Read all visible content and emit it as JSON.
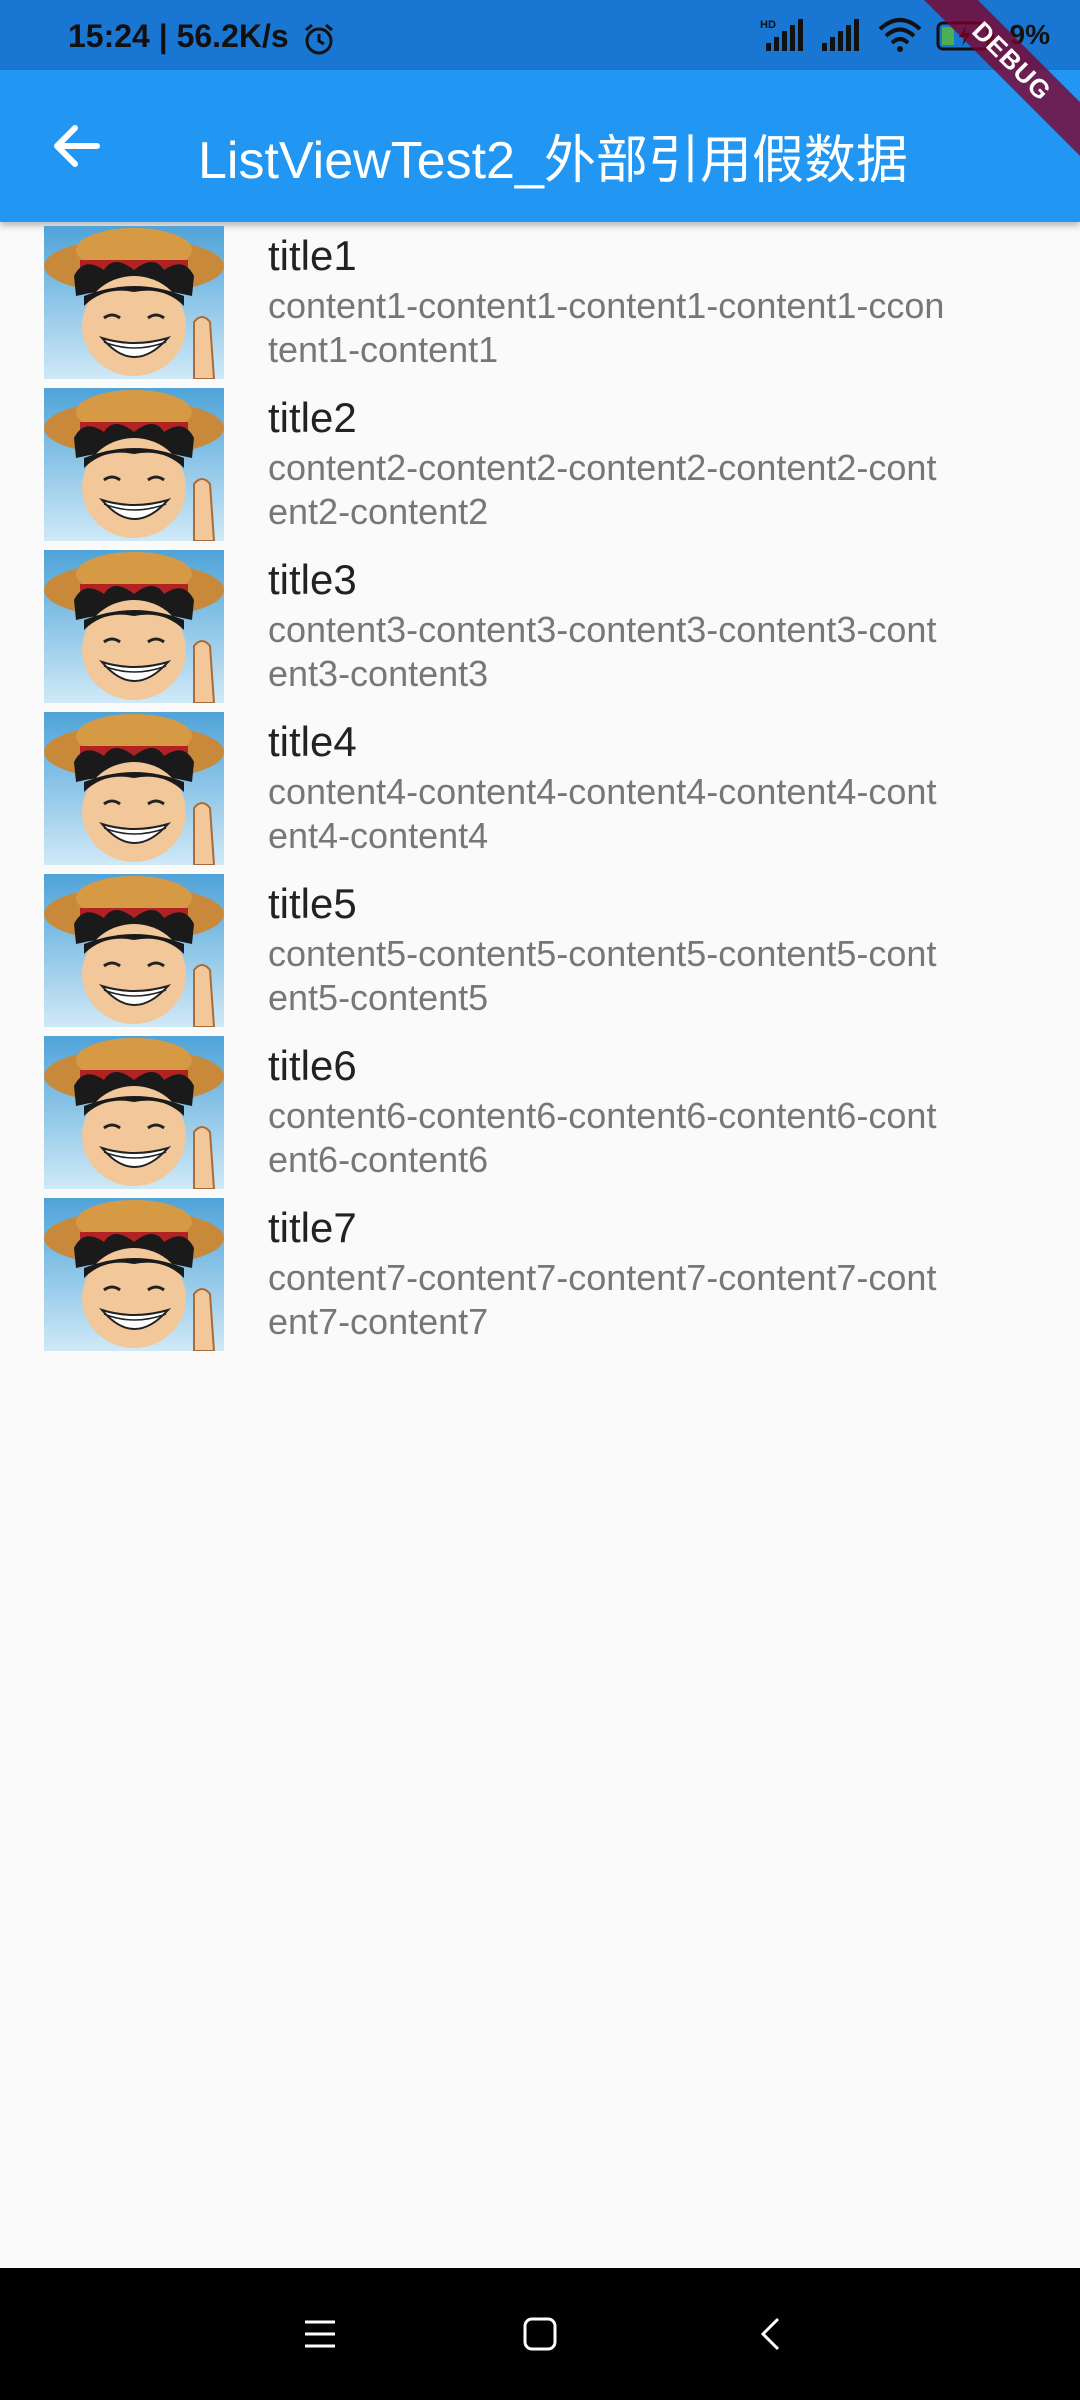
{
  "status_bar": {
    "time": "15:24 | 56.2K/s",
    "battery": "9%"
  },
  "app_bar": {
    "title": "ListViewTest2_外部引用假数据",
    "back_icon": "arrow-back-icon"
  },
  "debug_banner": "DEBUG",
  "list": {
    "items": [
      {
        "title": "title1",
        "content": "content1-content1-content1-content1-ccontent1-content1"
      },
      {
        "title": "title2",
        "content": "content2-content2-content2-content2-content2-content2"
      },
      {
        "title": "title3",
        "content": "content3-content3-content3-content3-content3-content3"
      },
      {
        "title": "title4",
        "content": "content4-content4-content4-content4-content4-content4"
      },
      {
        "title": "title5",
        "content": "content5-content5-content5-content5-content5-content5"
      },
      {
        "title": "title6",
        "content": "content6-content6-content6-content6-content6-content6"
      },
      {
        "title": "title7",
        "content": "content7-content7-content7-content7-content7-content7"
      }
    ]
  },
  "nav_bar": {
    "icons": [
      "menu-icon",
      "home-icon",
      "back-icon"
    ]
  },
  "colors": {
    "app_bar": "#2196f3",
    "status_bar": "#1976d2",
    "background": "#fafafa"
  }
}
